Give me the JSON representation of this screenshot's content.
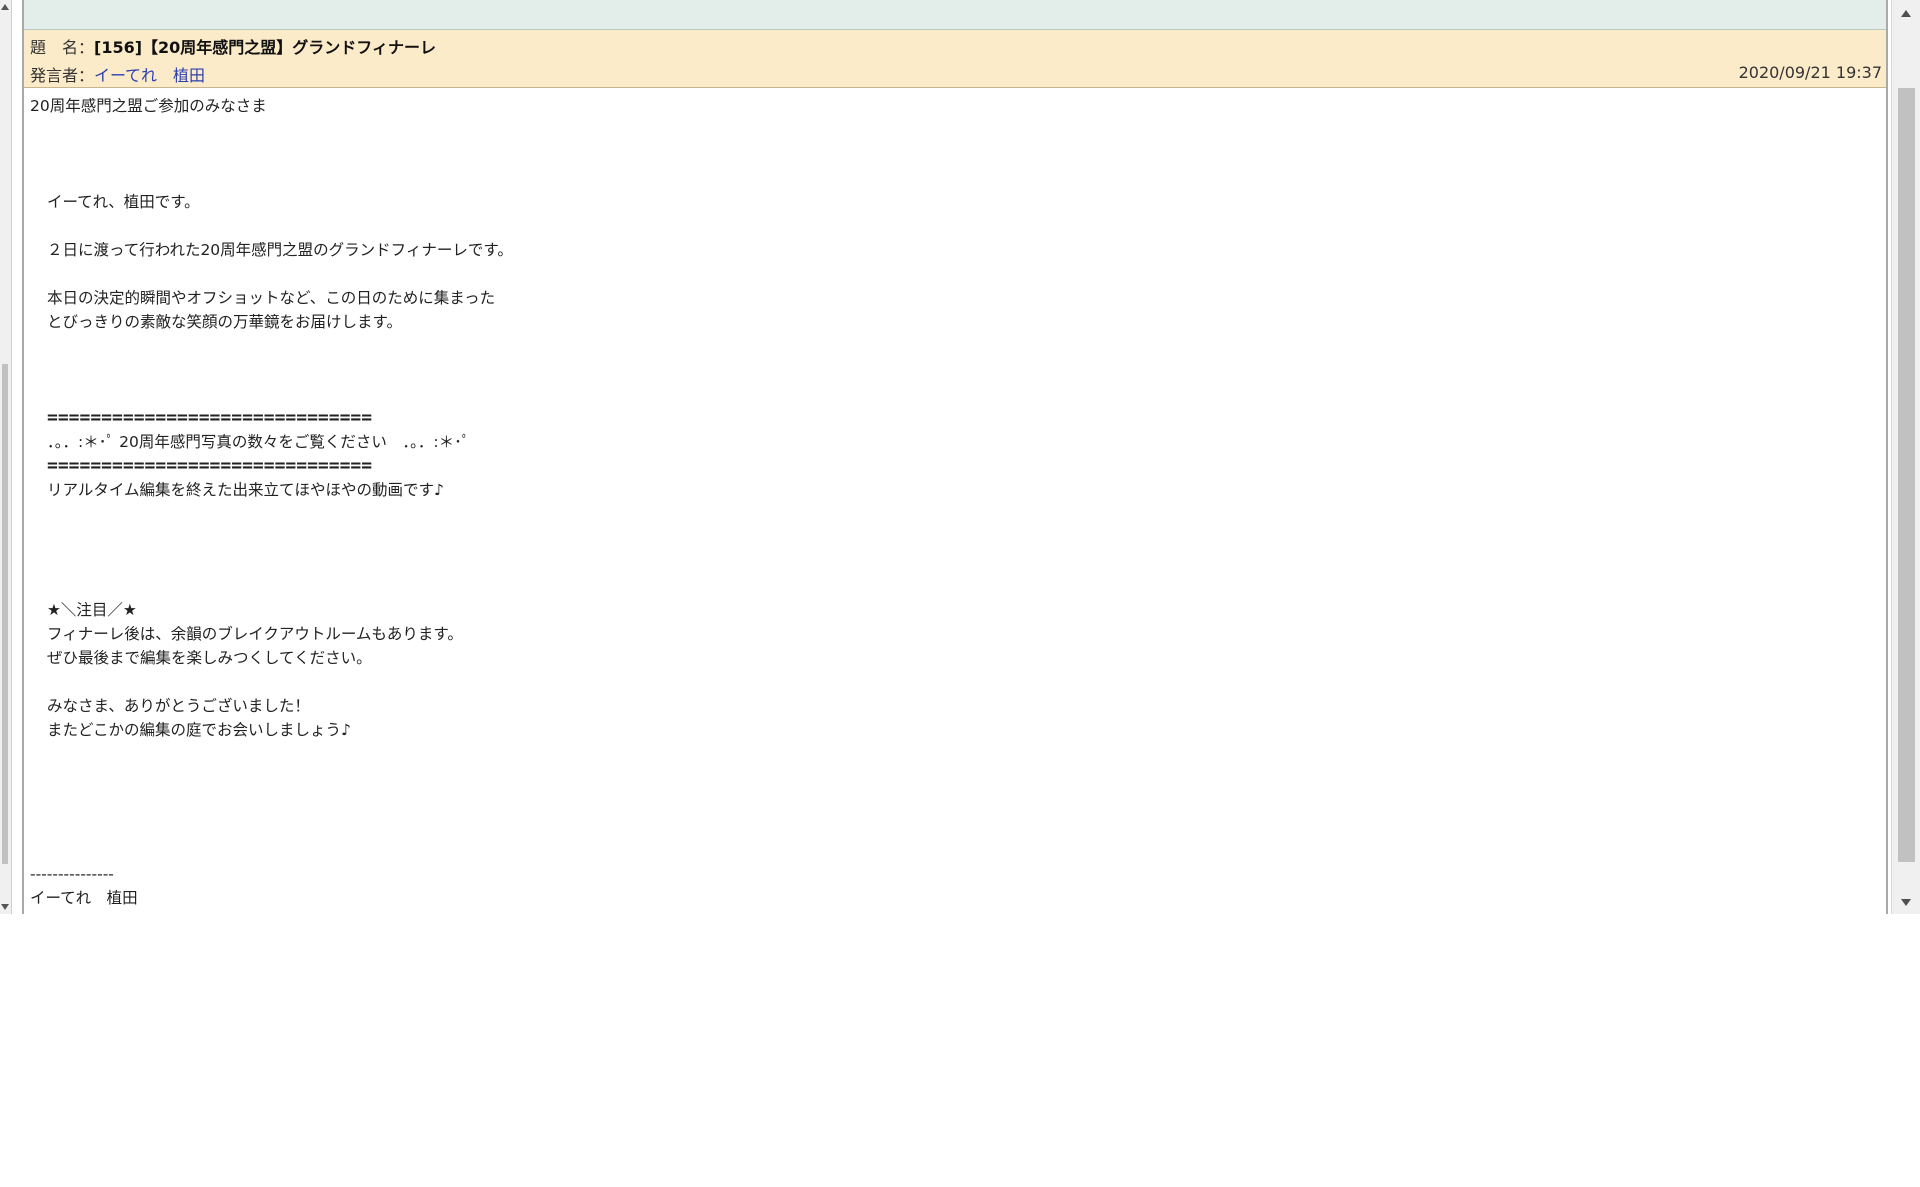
{
  "header": {
    "title_label": "題　名：",
    "title": "[156]【20周年感門之盟】グランドフィナーレ",
    "author_label": "発言者：",
    "author": "イーてれ　植田",
    "date": "2020/09/21 19:37"
  },
  "body": {
    "greeting": "20周年感門之盟ご参加のみなさま",
    "intro": "イーてれ、植田です。",
    "line_finale": "２日に渡って行われた20周年感門之盟のグランドフィナーレです。",
    "line_moments_1": "本日の決定的瞬間やオフショットなど、この日のために集まった",
    "line_moments_2": "とびっきりの素敵な笑顔の万華鏡をお届けします。",
    "rule_top": "==============================",
    "banner": "．。．:＊･ﾟ 20周年感門写真の数々をご覧ください　．。．:＊･ﾟ",
    "rule_bottom": "==============================",
    "line_video": "リアルタイム編集を終えた出来立てほやほやの動画です♪",
    "attention": "★＼注目／★",
    "line_breakout": "フィナーレ後は、余韻のブレイクアウトルームもあります。",
    "line_enjoy": "ぜひ最後まで編集を楽しみつくしてください。",
    "line_thanks": "みなさま、ありがとうございました！",
    "line_meet": "またどこかの編集の庭でお会いしましょう♪",
    "signature_rule": "---------------",
    "signature": "イーてれ　植田"
  },
  "colors": {
    "header_bg": "#fcebc9",
    "top_strip_bg": "#e3eeea",
    "author_link": "#2a3fb0"
  }
}
